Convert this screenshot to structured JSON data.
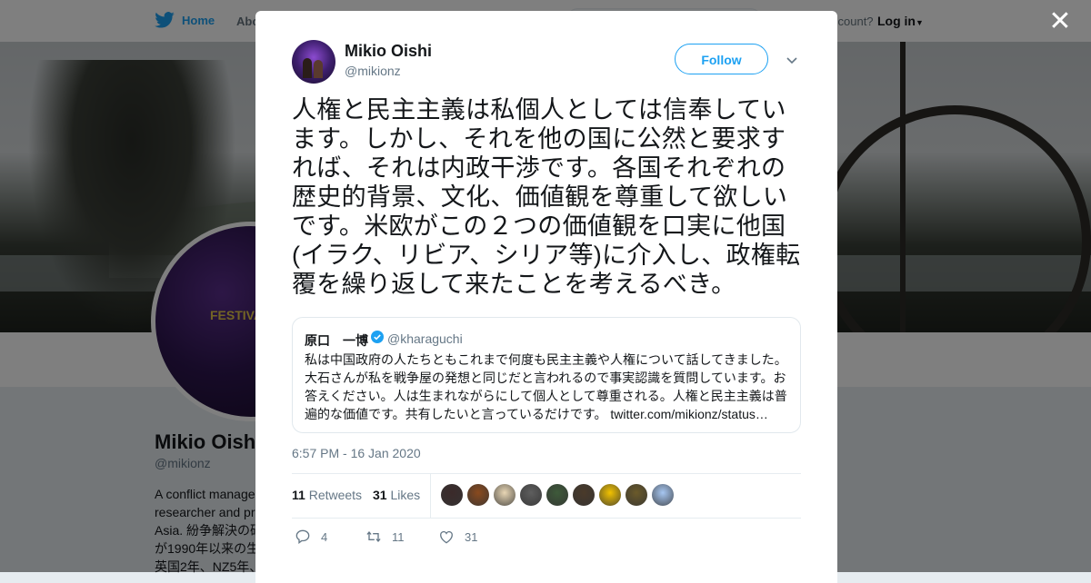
{
  "nav": {
    "home_label": "Home",
    "about_label": "Abo",
    "account_text": "ccount?",
    "login_label": "Log in"
  },
  "background_profile": {
    "name": "Mikio Oishi",
    "handle": "@mikionz",
    "avatar_text": "FESTIVAL",
    "bio": "A conflict manage researcher and pr Asia. 紛争解決の研 が1990年以来の生 英国2年、NZ5年、"
  },
  "modal": {
    "close_icon": "close-icon",
    "author": {
      "name": "Mikio Oishi",
      "handle": "@mikionz"
    },
    "follow_label": "Follow",
    "tweet_text": "人権と民主主義は私個人としては信奉しています。しかし、それを他の国に公然と要求すれば、それは内政干渉です。各国それぞれの歴史的背景、文化、価値観を尊重して欲しいです。米欧がこの２つの価値観を口実に他国(イラク、リビア、シリア等)に介入し、政権転覆を繰り返して来たことを考えるべき。",
    "quoted": {
      "name": "原口　一博",
      "handle": "@kharaguchi",
      "text": "私は中国政府の人たちともこれまで何度も民主主義や人権について話してきました。大石さんが私を戦争屋の発想と同じだと言われるので事実認識を質問しています。お答えください。人は生まれながらにして個人として尊重される。人権と民主主義は普遍的な価値です。共有したいと言っているだけです。",
      "link": "twitter.com/mikionz/status…"
    },
    "timestamp": "6:57 PM - 16 Jan 2020",
    "stats": {
      "retweets_count": "11",
      "retweets_label": "Retweets",
      "likes_count": "31",
      "likes_label": "Likes"
    },
    "liker_colors": [
      "#3b2a2a",
      "#8a4a1e",
      "#e8d6b4",
      "#5e5e5e",
      "#3e5a3a",
      "#4a3a2a",
      "#f2c200",
      "#6b5a2a",
      "#a7c7f2"
    ],
    "actions": {
      "reply_count": "4",
      "retweet_count": "11",
      "like_count": "31"
    },
    "accent_color": "#1da1f2"
  }
}
